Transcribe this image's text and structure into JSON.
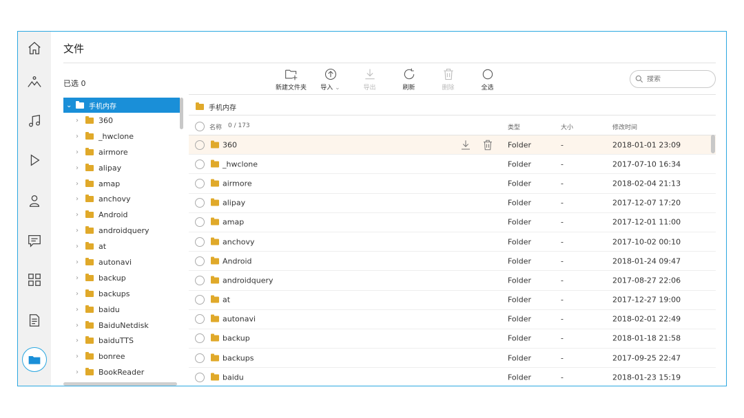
{
  "title": "文件",
  "selected_count": "已选 0",
  "toolbar": {
    "new_folder": "新建文件夹",
    "import": "导入",
    "export": "导出",
    "refresh": "刷新",
    "delete": "删除",
    "select_all": "全选"
  },
  "search": {
    "placeholder": "搜索"
  },
  "tree": {
    "root": "手机内存",
    "items": [
      "360",
      "_hwclone",
      "airmore",
      "alipay",
      "amap",
      "anchovy",
      "Android",
      "androidquery",
      "at",
      "autonavi",
      "backup",
      "backups",
      "baidu",
      "BaiduNetdisk",
      "baiduTTS",
      "bonree",
      "BookReader"
    ]
  },
  "path": "手机内存",
  "columns": {
    "name": "名称",
    "count": "0 / 173",
    "type": "类型",
    "size": "大小",
    "modified": "修改时间"
  },
  "rows": [
    {
      "name": "360",
      "type": "Folder",
      "size": "-",
      "date": "2018-01-01 23:09"
    },
    {
      "name": "_hwclone",
      "type": "Folder",
      "size": "-",
      "date": "2017-07-10 16:34"
    },
    {
      "name": "airmore",
      "type": "Folder",
      "size": "-",
      "date": "2018-02-04 21:13"
    },
    {
      "name": "alipay",
      "type": "Folder",
      "size": "-",
      "date": "2017-12-07 17:20"
    },
    {
      "name": "amap",
      "type": "Folder",
      "size": "-",
      "date": "2017-12-01 11:00"
    },
    {
      "name": "anchovy",
      "type": "Folder",
      "size": "-",
      "date": "2017-10-02 00:10"
    },
    {
      "name": "Android",
      "type": "Folder",
      "size": "-",
      "date": "2018-01-24 09:47"
    },
    {
      "name": "androidquery",
      "type": "Folder",
      "size": "-",
      "date": "2017-08-27 22:06"
    },
    {
      "name": "at",
      "type": "Folder",
      "size": "-",
      "date": "2017-12-27 19:00"
    },
    {
      "name": "autonavi",
      "type": "Folder",
      "size": "-",
      "date": "2018-02-01 22:49"
    },
    {
      "name": "backup",
      "type": "Folder",
      "size": "-",
      "date": "2018-01-18 21:58"
    },
    {
      "name": "backups",
      "type": "Folder",
      "size": "-",
      "date": "2017-09-25 22:47"
    },
    {
      "name": "baidu",
      "type": "Folder",
      "size": "-",
      "date": "2018-01-23 15:19"
    }
  ],
  "rail_icons": [
    "home-icon",
    "photos-icon",
    "music-icon",
    "video-icon",
    "contacts-icon",
    "messages-icon",
    "apps-icon",
    "documents-icon",
    "files-icon"
  ],
  "colors": {
    "accent": "#1a8fd8",
    "border": "#2aa7e0",
    "folder": "#e0a92a",
    "hover_row": "#fdf5ec"
  }
}
